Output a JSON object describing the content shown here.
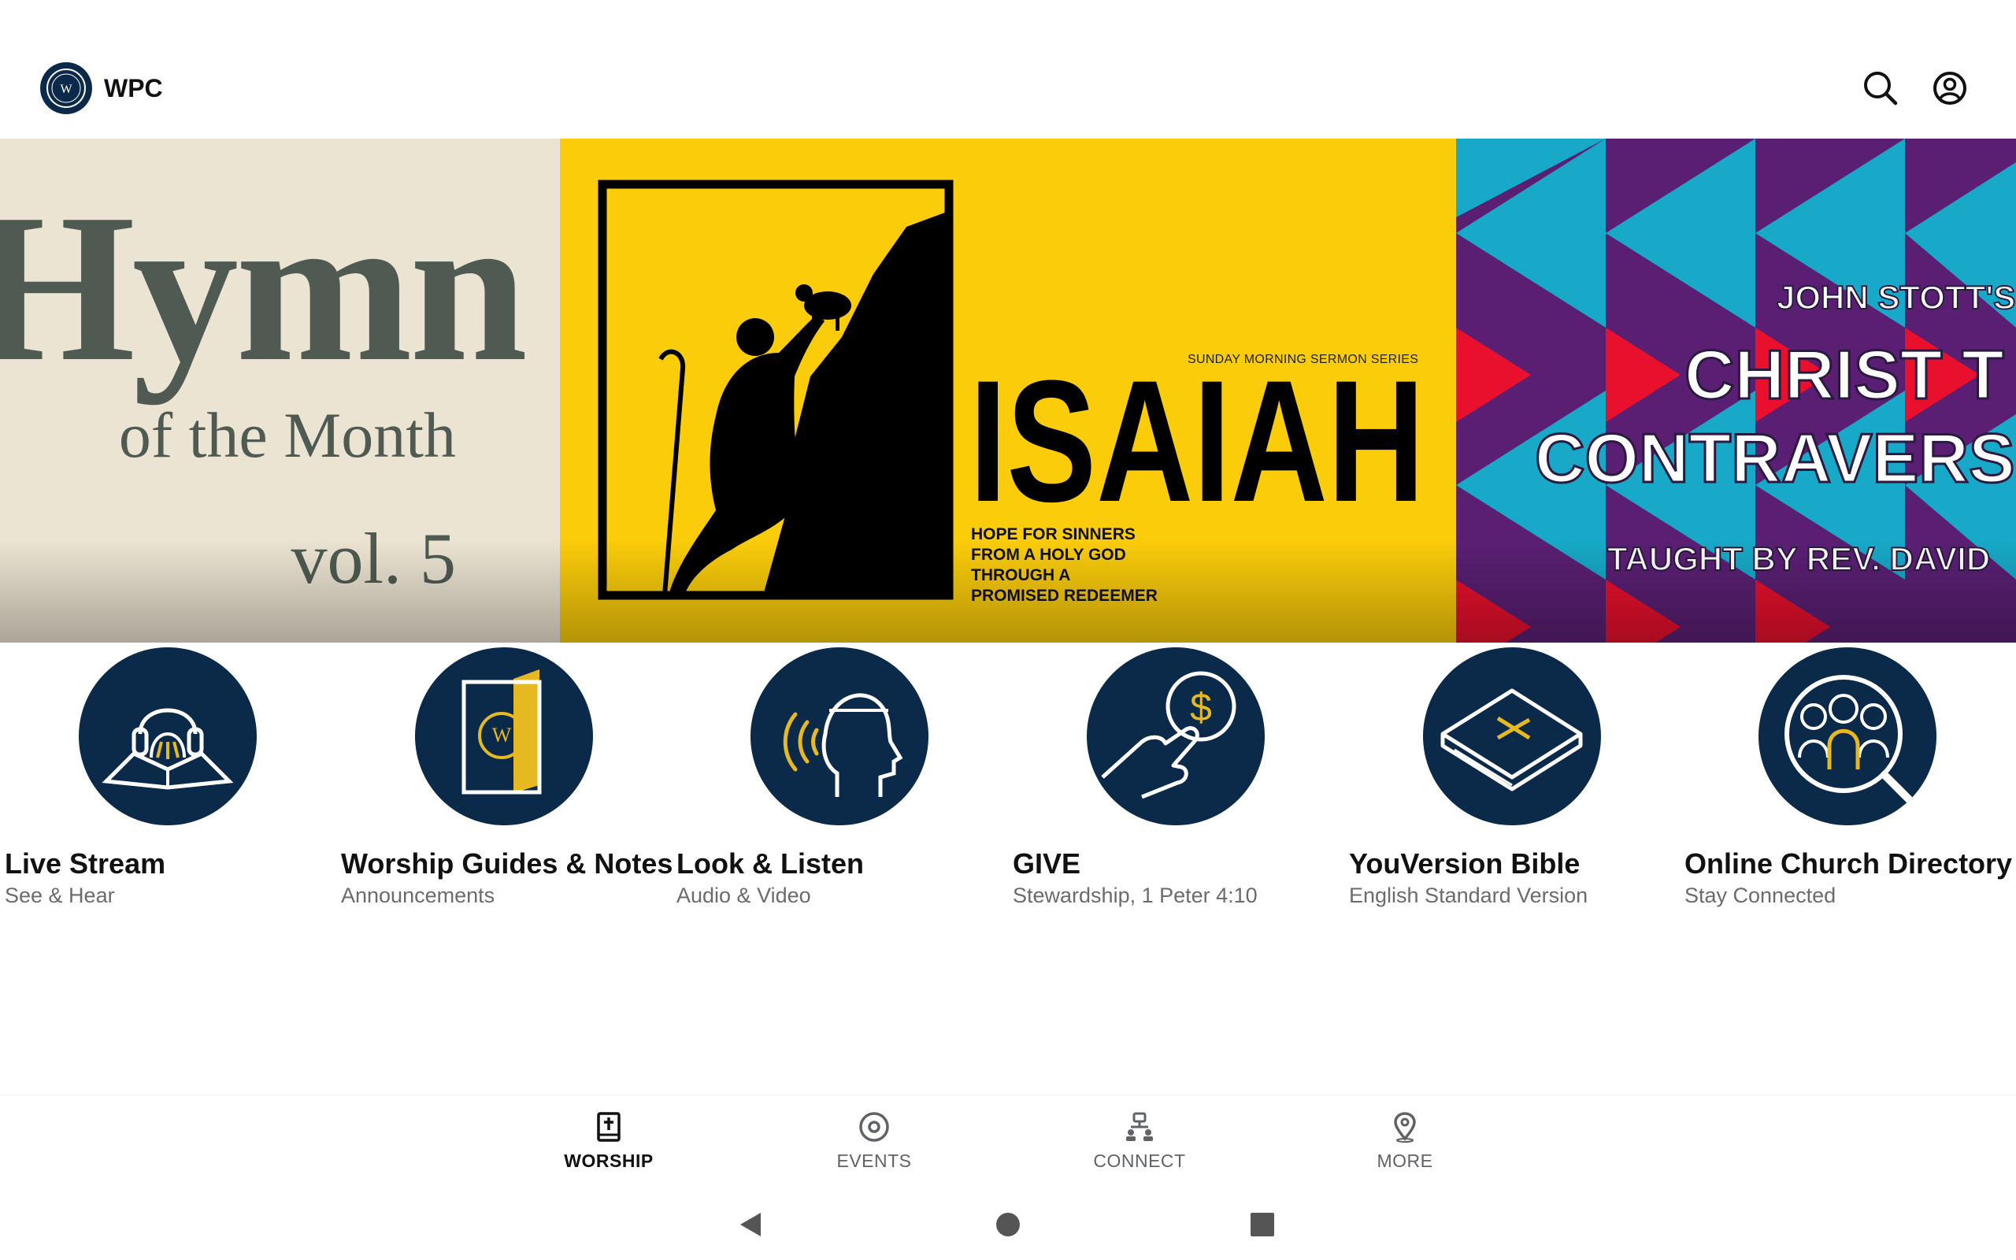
{
  "app": {
    "title": "WPC",
    "logo_icon": "wpc-seal-logo"
  },
  "header": {
    "search_icon": "search-icon",
    "account_icon": "account-circle-icon"
  },
  "carousel": {
    "slides": [
      {
        "name": "hymn-of-the-month",
        "title": "Hymn",
        "subtitle": "of the Month",
        "volume": "vol. 5",
        "background": "#ece4d2",
        "text_color": "#4f5b52"
      },
      {
        "name": "isaiah-sermon-series",
        "kicker": "SUNDAY MORNING SERMON SERIES",
        "title": "ISAIAH",
        "tagline": "HOPE FOR SINNERS\nFROM A HOLY GOD\nTHROUGH A\nPROMISED REDEEMER",
        "background": "#facc0a"
      },
      {
        "name": "christ-the-controversialist",
        "line1": "JOHN STOTT'S",
        "line2": "CHRIST T",
        "line3": "CONTRAVERS",
        "line4": "TAUGHT BY REV. DAVID",
        "background": "#5a1f73"
      }
    ],
    "page_count": 5,
    "active_page": 1
  },
  "tiles": [
    {
      "title": "Live Stream",
      "subtitle": "See & Hear",
      "icon": "headphones-bible-icon"
    },
    {
      "title": "Worship Guides & Notes",
      "subtitle": "Announcements",
      "icon": "bulletin-booklet-icon"
    },
    {
      "title": "Look & Listen",
      "subtitle": "Audio & Video",
      "icon": "listening-head-icon"
    },
    {
      "title": "GIVE",
      "subtitle": "Stewardship, 1 Peter 4:10",
      "icon": "give-coin-icon"
    },
    {
      "title": "YouVersion Bible",
      "subtitle": "English Standard Version",
      "icon": "bible-book-icon"
    },
    {
      "title": "Online Church Directory",
      "subtitle": "Stay Connected",
      "icon": "people-directory-icon"
    }
  ],
  "bottom_nav": {
    "items": [
      {
        "label": "WORSHIP",
        "icon": "bible-cross-icon",
        "active": true
      },
      {
        "label": "EVENTS",
        "icon": "target-circle-icon",
        "active": false
      },
      {
        "label": "CONNECT",
        "icon": "network-people-icon",
        "active": false
      },
      {
        "label": "MORE",
        "icon": "location-pin-icon",
        "active": false
      }
    ]
  },
  "system_nav": {
    "back_icon": "back-triangle-icon",
    "home_icon": "home-circle-icon",
    "recents_icon": "recents-square-icon"
  },
  "colors": {
    "navy": "#0b2a4a",
    "gold": "#e6b822",
    "yellow": "#facc0a",
    "purple": "#5a1f73",
    "cyan": "#17a9c7",
    "red": "#e8102c"
  }
}
